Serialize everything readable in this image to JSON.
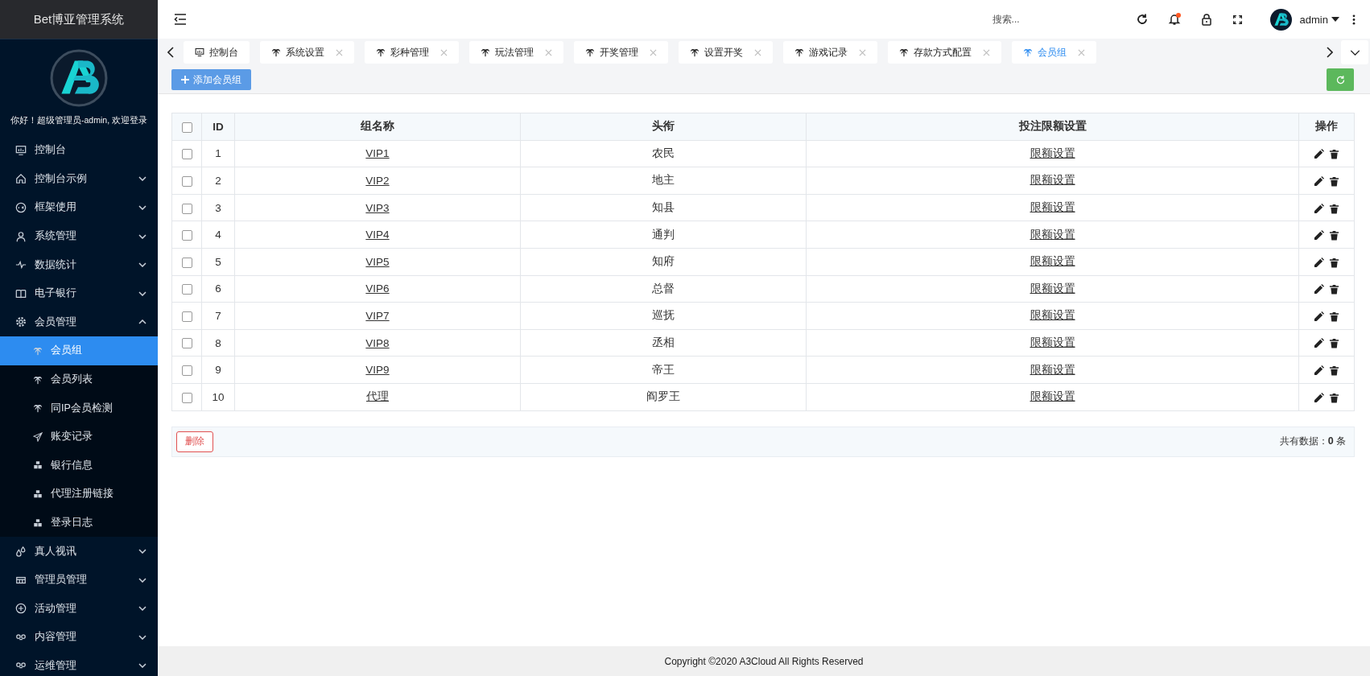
{
  "sidebar": {
    "title": "Bet博亚管理系统",
    "greeting": "你好！超级管理员-admin, 欢迎登录",
    "items": [
      {
        "label": "控制台",
        "selected": false
      },
      {
        "label": "控制台示例",
        "selected": false,
        "expanded": false
      },
      {
        "label": "框架使用",
        "selected": false,
        "expanded": false
      },
      {
        "label": "系统管理",
        "selected": false,
        "expanded": false
      },
      {
        "label": "数据统计",
        "selected": false,
        "expanded": false
      },
      {
        "label": "电子银行",
        "selected": false,
        "expanded": false
      },
      {
        "label": "会员管理",
        "selected": false,
        "expanded": true,
        "children": [
          {
            "label": "会员组",
            "selected": true
          },
          {
            "label": "会员列表",
            "selected": false
          },
          {
            "label": "同IP会员检测",
            "selected": false
          },
          {
            "label": "账变记录",
            "selected": false
          },
          {
            "label": "银行信息",
            "selected": false
          },
          {
            "label": "代理注册链接",
            "selected": false
          },
          {
            "label": "登录日志",
            "selected": false
          }
        ]
      },
      {
        "label": "真人视讯",
        "selected": false,
        "expanded": false
      },
      {
        "label": "管理员管理",
        "selected": false,
        "expanded": false
      },
      {
        "label": "活动管理",
        "selected": false,
        "expanded": false
      },
      {
        "label": "内容管理",
        "selected": false,
        "expanded": false
      },
      {
        "label": "运维管理",
        "selected": false,
        "expanded": false
      }
    ]
  },
  "header": {
    "search": {
      "placeholder": "搜索..."
    },
    "notification_unread": true,
    "user": "admin"
  },
  "tabs": [
    {
      "label": "控制台",
      "selected": false,
      "closable": false
    },
    {
      "label": "系统设置",
      "selected": false,
      "closable": true
    },
    {
      "label": "彩种管理",
      "selected": false,
      "closable": true
    },
    {
      "label": "玩法管理",
      "selected": false,
      "closable": true
    },
    {
      "label": "开奖管理",
      "selected": false,
      "closable": true
    },
    {
      "label": "设置开奖",
      "selected": false,
      "closable": true
    },
    {
      "label": "游戏记录",
      "selected": false,
      "closable": true
    },
    {
      "label": "存款方式配置",
      "selected": false,
      "closable": true
    },
    {
      "label": "会员组",
      "selected": true,
      "closable": true
    }
  ],
  "toolbar": {
    "add_button": "添加会员组"
  },
  "table": {
    "columns": [
      "ID",
      "组名称",
      "头衔",
      "投注限额设置",
      "操作"
    ],
    "all_checked": false,
    "rows": [
      {
        "checked": false,
        "id": "1",
        "name": "VIP1",
        "title": "农民",
        "limit": "限额设置"
      },
      {
        "checked": false,
        "id": "2",
        "name": "VIP2",
        "title": "地主",
        "limit": "限额设置"
      },
      {
        "checked": false,
        "id": "3",
        "name": "VIP3",
        "title": "知县",
        "limit": "限额设置"
      },
      {
        "checked": false,
        "id": "4",
        "name": "VIP4",
        "title": "通判",
        "limit": "限额设置"
      },
      {
        "checked": false,
        "id": "5",
        "name": "VIP5",
        "title": "知府",
        "limit": "限额设置"
      },
      {
        "checked": false,
        "id": "6",
        "name": "VIP6",
        "title": "总督",
        "limit": "限额设置"
      },
      {
        "checked": false,
        "id": "7",
        "name": "VIP7",
        "title": "巡抚",
        "limit": "限额设置"
      },
      {
        "checked": false,
        "id": "8",
        "name": "VIP8",
        "title": "丞相",
        "limit": "限额设置"
      },
      {
        "checked": false,
        "id": "9",
        "name": "VIP9",
        "title": "帝王",
        "limit": "限额设置"
      },
      {
        "checked": false,
        "id": "10",
        "name": "代理",
        "title": "阎罗王",
        "limit": "限额设置"
      }
    ]
  },
  "table_footer": {
    "delete_button": "删除",
    "total_label": "共有数据：",
    "total": "0",
    "unit": "条"
  },
  "copyright": "Copyright ©2020 A3Cloud All Rights Reserved"
}
